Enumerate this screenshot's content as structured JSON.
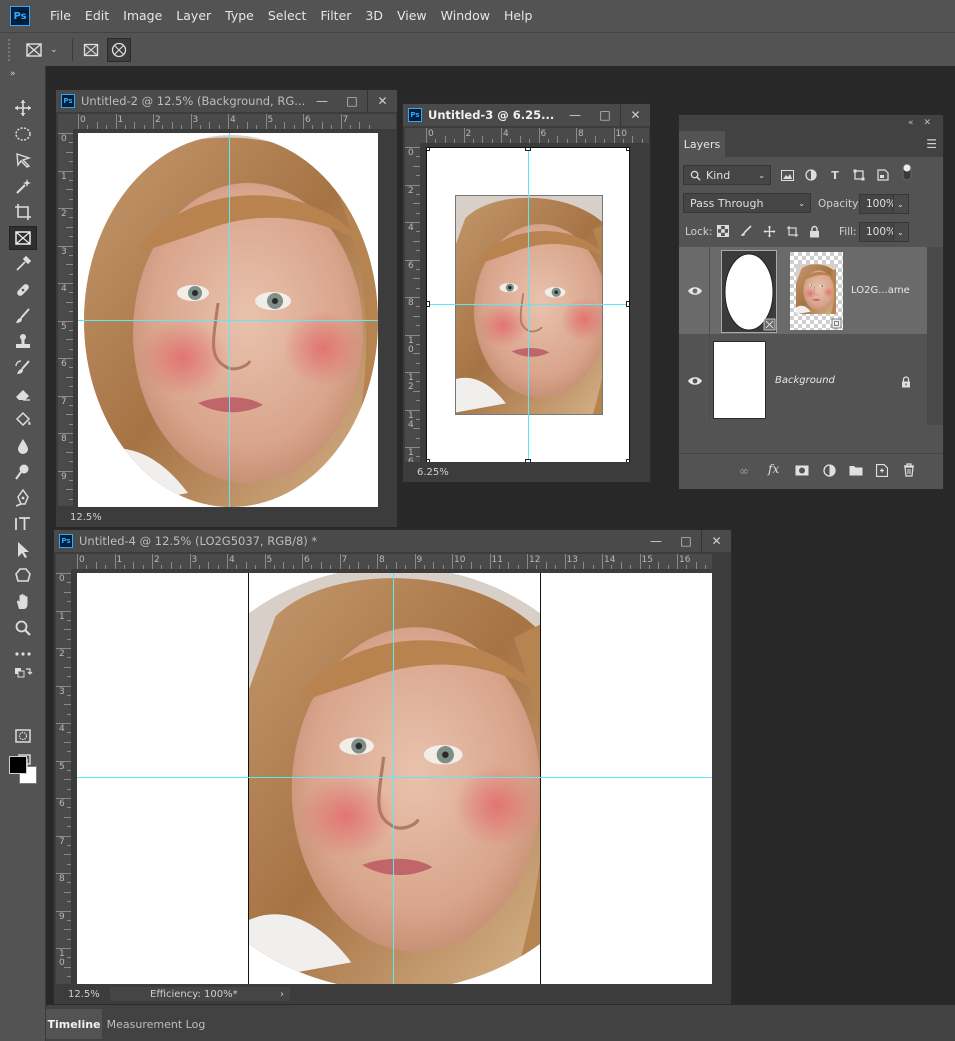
{
  "app": {
    "logo_text": "Ps"
  },
  "menu": [
    "File",
    "Edit",
    "Image",
    "Layer",
    "Type",
    "Select",
    "Filter",
    "3D",
    "View",
    "Window",
    "Help"
  ],
  "options_bar": {
    "tool_preset_icon": "frame-tool-icon",
    "buttons": [
      "rectangular-frame-icon",
      "elliptical-frame-icon"
    ]
  },
  "toolbar": {
    "tools": [
      "move-tool-icon",
      "elliptical-marquee-icon",
      "lasso-tool-icon",
      "magic-wand-icon",
      "crop-tool-icon",
      "frame-tool-icon",
      "eyedropper-icon",
      "healing-brush-icon",
      "brush-tool-icon",
      "clone-stamp-icon",
      "history-brush-icon",
      "eraser-icon",
      "paint-bucket-icon",
      "blur-tool-icon",
      "dodge-tool-icon",
      "pen-tool-icon",
      "type-tool-icon",
      "path-selection-icon",
      "shape-tool-icon",
      "hand-tool-icon",
      "zoom-tool-icon",
      "more-tools-icon",
      "swap-colors-icon",
      "quick-mask-icon",
      "screen-mode-icon"
    ],
    "foreground_color": "#000000",
    "background_color": "#ffffff"
  },
  "documents": {
    "doc2": {
      "title": "Untitled-2 @ 12.5% (Background, RG...",
      "zoom": "12.5%",
      "ruler_h": [
        "0",
        "1",
        "2",
        "3",
        "4",
        "5",
        "6",
        "7"
      ],
      "ruler_v": [
        "0",
        "1",
        "2",
        "3",
        "4",
        "5",
        "6",
        "7",
        "8",
        "9"
      ]
    },
    "doc3": {
      "title": "Untitled-3 @ 6.25...",
      "zoom": "6.25%",
      "ruler_h": [
        "0",
        "2",
        "4",
        "6",
        "8",
        "10"
      ],
      "ruler_v": [
        "0",
        "2",
        "4",
        "6",
        "8",
        "1\n0",
        "1\n2",
        "1\n4",
        "1\n6"
      ]
    },
    "doc4": {
      "title": "Untitled-4 @ 12.5% (LO2G5037, RGB/8) *",
      "zoom": "12.5%",
      "efficiency": "Efficiency: 100%*",
      "ruler_h": [
        "0",
        "1",
        "2",
        "3",
        "4",
        "5",
        "6",
        "7",
        "8",
        "9",
        "10",
        "11",
        "12",
        "13",
        "14",
        "15",
        "16"
      ],
      "ruler_v": [
        "0",
        "1",
        "2",
        "3",
        "4",
        "5",
        "6",
        "7",
        "8",
        "9",
        "1\n0"
      ]
    }
  },
  "layers_panel": {
    "tab_label": "Layers",
    "filter_kind": "Kind",
    "blend_mode": "Pass Through",
    "opacity_label": "Opacity:",
    "opacity_value": "100%",
    "lock_label": "Lock:",
    "fill_label": "Fill:",
    "fill_value": "100%",
    "layers": [
      {
        "name": "LO2G...ame",
        "italic": false,
        "visible": true,
        "selected": true
      },
      {
        "name": "Background",
        "italic": true,
        "visible": true,
        "locked": true
      }
    ]
  },
  "bottom_tabs": [
    "Timeline",
    "Measurement Log"
  ],
  "colors": {
    "guide": "#5ee8f5",
    "ui_dark": "#282828",
    "panel": "#535353"
  }
}
